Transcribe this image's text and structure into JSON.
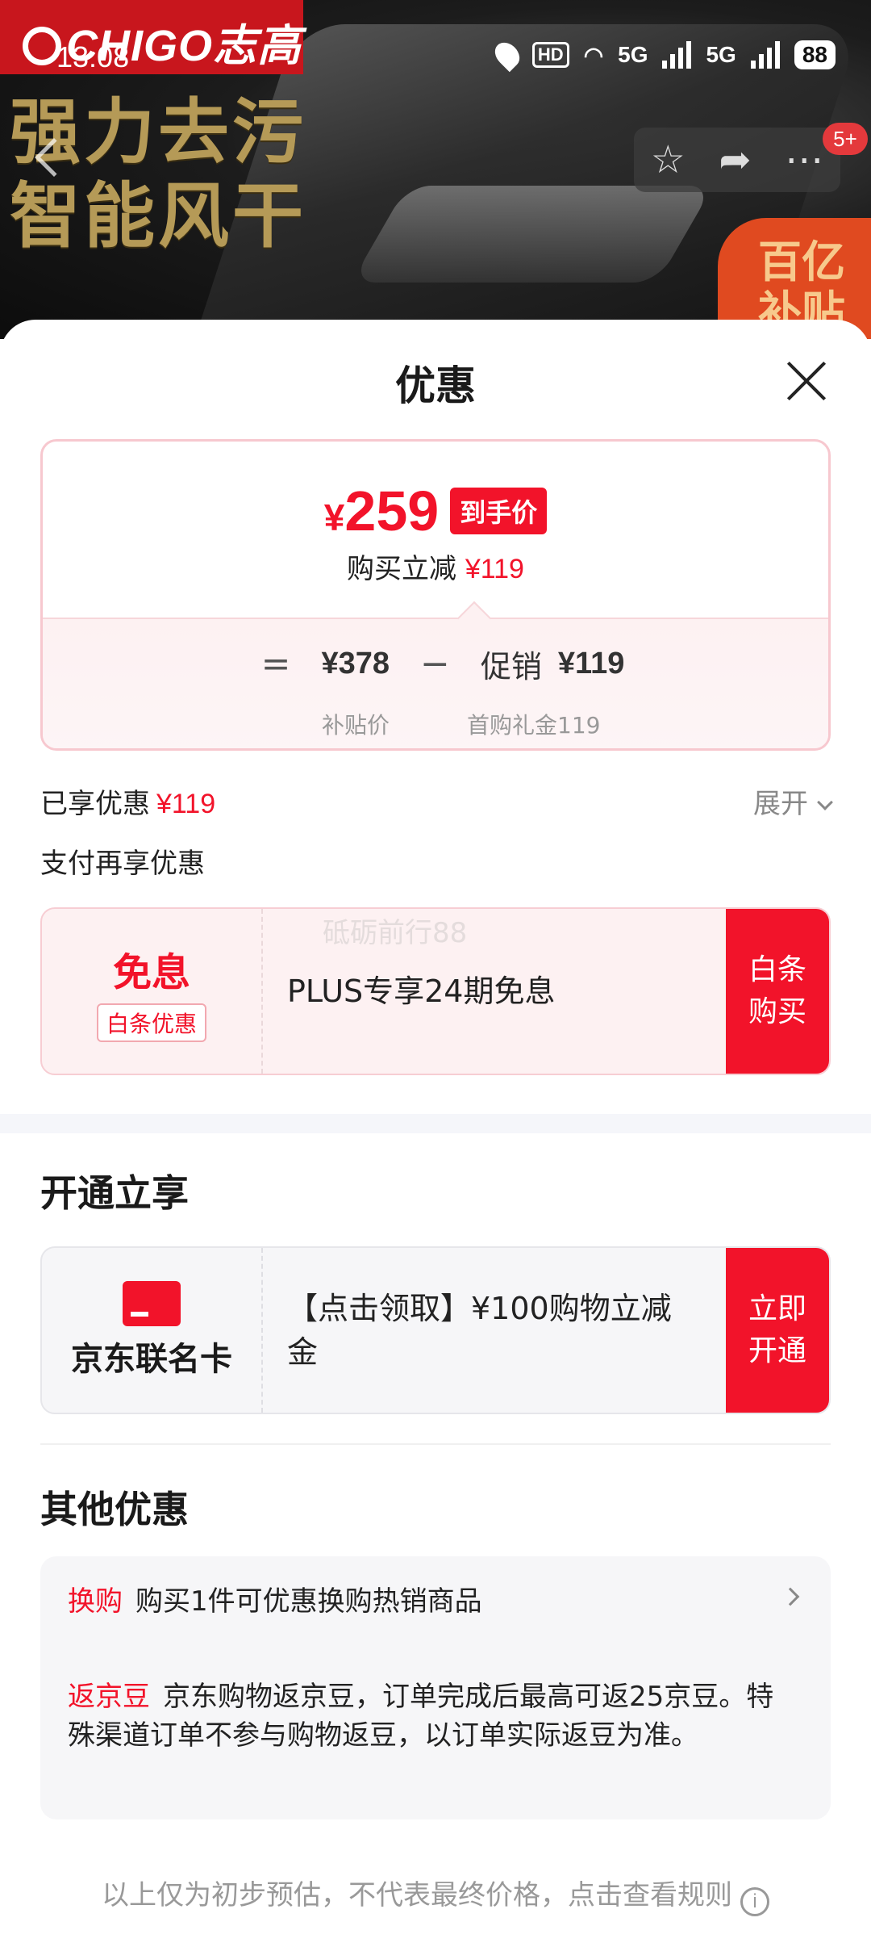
{
  "status_bar": {
    "time": "13:08",
    "hd": "HD",
    "net1": "5G",
    "net2": "5G",
    "battery": "88"
  },
  "header": {
    "brand": "CHIGO志高",
    "slogan_line1": "强力去污",
    "slogan_line2": "智能风干",
    "cart_badge": "5+",
    "subsidy_line1": "百亿",
    "subsidy_line2": "补贴"
  },
  "sheet": {
    "title": "优惠"
  },
  "price_card": {
    "final_price_symbol": "¥",
    "final_price": "259",
    "final_tag": "到手价",
    "reduce_label": "购买立减",
    "reduce_value": "¥119",
    "equals": "=",
    "base_price": "¥378",
    "base_label": "补贴价",
    "minus": "−",
    "promo_label": "促销",
    "promo_value": "¥119",
    "promo_sublabel": "首购礼金119"
  },
  "enjoyed": {
    "label": "已享优惠",
    "value": "¥119",
    "expand": "展开"
  },
  "pay_section": {
    "title": "支付再享优惠"
  },
  "installment_offer": {
    "type": "免息",
    "tag": "白条优惠",
    "description": "PLUS专享24期免息",
    "button": "白条\n购买",
    "watermark": "砥砺前行88"
  },
  "open_section": {
    "title": "开通立享"
  },
  "card_offer": {
    "name": "京东联名卡",
    "description": "【点击领取】¥100购物立减金",
    "button": "立即\n开通"
  },
  "other_section": {
    "title": "其他优惠",
    "items": [
      {
        "tag": "换购",
        "text": "购买1件可优惠换购热销商品"
      },
      {
        "tag": "返京豆",
        "text": "京东购物返京豆，订单完成后最高可返25京豆。特殊渠道订单不参与购物返豆，以订单实际返豆为准。"
      }
    ]
  },
  "footer": {
    "note": "以上仅为初步预估，不代表最终价格，点击查看规则",
    "info_icon": "i"
  }
}
